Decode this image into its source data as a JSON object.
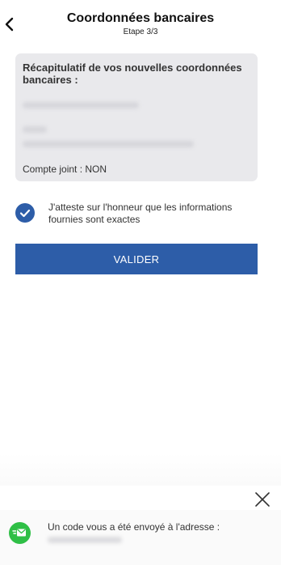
{
  "header": {
    "title": "Coordonnées bancaires",
    "step": "Etape 3/3"
  },
  "summary": {
    "heading": "Récapitulatif de vos nouvelles coordonnées bancaires :",
    "joint_account": "Compte joint : NON"
  },
  "attestation": {
    "text": "J'atteste sur l'honneur que les informations fournies sont exactes",
    "checked": true
  },
  "actions": {
    "validate_label": "VALIDER"
  },
  "toast": {
    "message": "Un code vous a été envoyé à l'adresse :"
  },
  "colors": {
    "primary": "#2d5da8",
    "card_background": "#e9e9ec",
    "success_green": "#2fbf46"
  },
  "icons": {
    "back": "chevron-left-icon",
    "check": "check-circle-icon",
    "close": "close-icon",
    "mail": "mail-icon"
  }
}
